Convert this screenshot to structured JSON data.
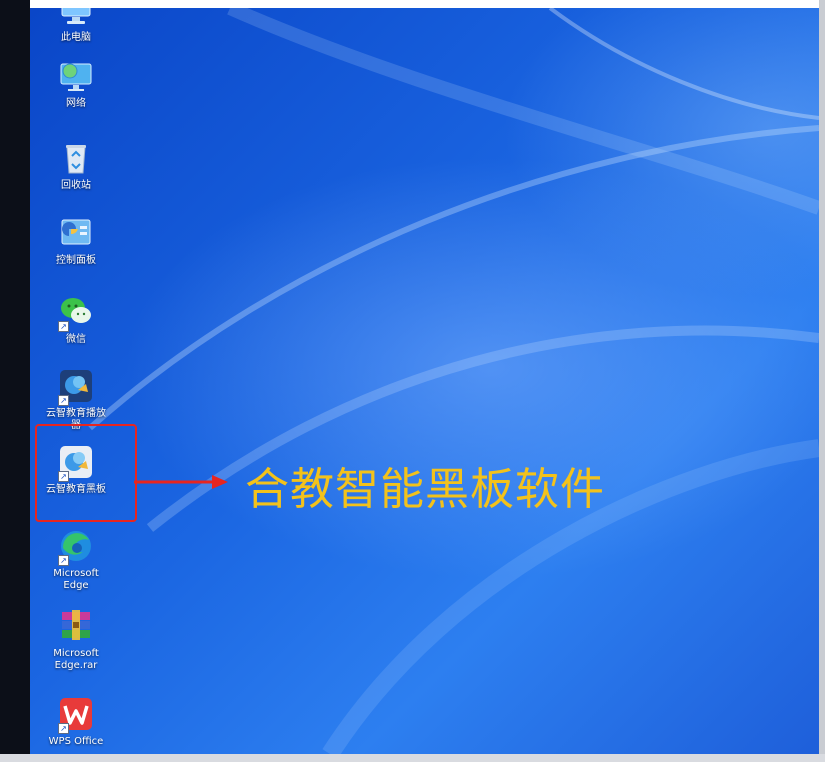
{
  "desktop": {
    "icons": [
      {
        "label": "此电脑",
        "icon": "computer-icon"
      },
      {
        "label": "网络",
        "icon": "network-icon"
      },
      {
        "label": "回收站",
        "icon": "recycle-bin-icon"
      },
      {
        "label": "控制面板",
        "icon": "control-panel-icon"
      },
      {
        "label": "微信",
        "icon": "wechat-icon"
      },
      {
        "label": "云智教育播放\n器",
        "icon": "yunzhi-player-icon"
      },
      {
        "label": "云智教育黑板",
        "icon": "yunzhi-blackboard-icon"
      },
      {
        "label": "Microsoft\nEdge",
        "icon": "edge-icon"
      },
      {
        "label": "Microsoft\nEdge.rar",
        "icon": "winrar-archive-icon"
      },
      {
        "label": "WPS Office",
        "icon": "wps-office-icon"
      }
    ]
  },
  "annotation": {
    "caption": "合教智能黑板软件",
    "box_color": "#e8251f",
    "caption_color": "#f3c21b"
  },
  "colors": {
    "desktop_blue": "#1b66e2"
  }
}
